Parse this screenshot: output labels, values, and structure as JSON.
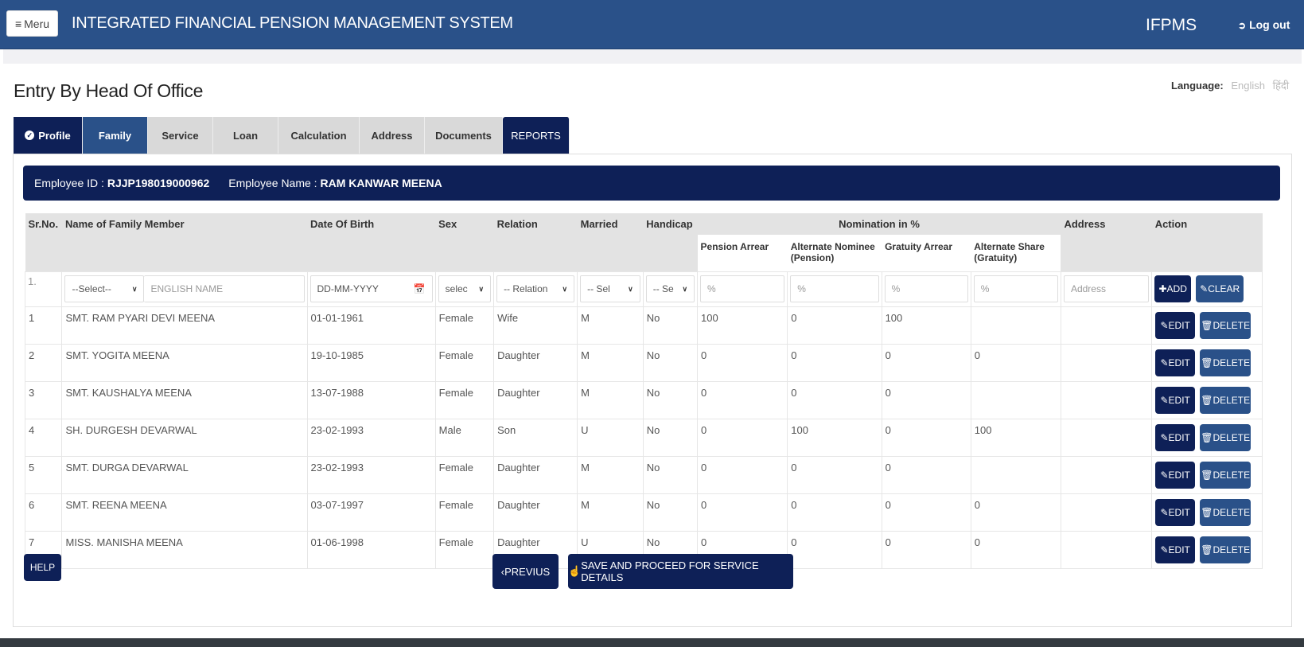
{
  "header": {
    "menu_label": "Meru",
    "app_title": "INTEGRATED FINANCIAL PENSION MANAGEMENT SYSTEM",
    "brand": "IFPMS",
    "logout_label": "Log out"
  },
  "language": {
    "label": "Language:",
    "options": [
      "English",
      "हिंदी"
    ]
  },
  "page_title": "Entry By Head Of Office",
  "tabs": [
    {
      "label": "Profile"
    },
    {
      "label": "Family"
    },
    {
      "label": "Service"
    },
    {
      "label": "Loan"
    },
    {
      "label": "Calculation"
    },
    {
      "label": "Address"
    },
    {
      "label": "Documents"
    },
    {
      "label": "REPORTS"
    }
  ],
  "employee": {
    "id_label": "Employee ID :",
    "id_value": "RJJP198019000962",
    "name_label": "Employee Name :",
    "name_value": "RAM KANWAR MEENA"
  },
  "table": {
    "headers": {
      "srno": "Sr.No.",
      "name": "Name of Family Member",
      "dob": "Date Of Birth",
      "sex": "Sex",
      "relation": "Relation",
      "married": "Married",
      "handicap": "Handicap",
      "nomination": "Nomination in %",
      "pension_arrear": "Pension Arrear",
      "alt_nominee": "Alternate Nominee (Pension)",
      "gratuity_arrear": "Gratuity Arrear",
      "alt_share": "Alternate Share (Gratuity)",
      "address": "Address",
      "action": "Action"
    },
    "input_row": {
      "srno": "1.",
      "title_select": "--Select--",
      "name_placeholder": "ENGLISH NAME",
      "dob_placeholder": "DD-MM-YYYY",
      "sex_select": "selec",
      "relation_select": "-- Relation",
      "married_select": "-- Sel",
      "handicap_select": "-- Se",
      "pct_placeholder": "%",
      "address_placeholder": "Address",
      "add_label": "ADD",
      "clear_label": "CLEAR"
    },
    "rows": [
      {
        "sr": "1",
        "name": "SMT. RAM PYARI DEVI MEENA",
        "dob": "01-01-1961",
        "sex": "Female",
        "relation": "Wife",
        "married": "M",
        "handicap": "No",
        "pension": "100",
        "alt_nominee": "0",
        "gratuity": "100",
        "alt_share": "",
        "address": ""
      },
      {
        "sr": "2",
        "name": "SMT. YOGITA MEENA",
        "dob": "19-10-1985",
        "sex": "Female",
        "relation": "Daughter",
        "married": "M",
        "handicap": "No",
        "pension": "0",
        "alt_nominee": "0",
        "gratuity": "0",
        "alt_share": "0",
        "address": ""
      },
      {
        "sr": "3",
        "name": "SMT. KAUSHALYA MEENA",
        "dob": "13-07-1988",
        "sex": "Female",
        "relation": "Daughter",
        "married": "M",
        "handicap": "No",
        "pension": "0",
        "alt_nominee": "0",
        "gratuity": "0",
        "alt_share": "",
        "address": ""
      },
      {
        "sr": "4",
        "name": "SH. DURGESH DEVARWAL",
        "dob": "23-02-1993",
        "sex": "Male",
        "relation": "Son",
        "married": "U",
        "handicap": "No",
        "pension": "0",
        "alt_nominee": "100",
        "gratuity": "0",
        "alt_share": "100",
        "address": ""
      },
      {
        "sr": "5",
        "name": "SMT. DURGA DEVARWAL",
        "dob": "23-02-1993",
        "sex": "Female",
        "relation": "Daughter",
        "married": "M",
        "handicap": "No",
        "pension": "0",
        "alt_nominee": "0",
        "gratuity": "0",
        "alt_share": "",
        "address": ""
      },
      {
        "sr": "6",
        "name": "SMT. REENA MEENA",
        "dob": "03-07-1997",
        "sex": "Female",
        "relation": "Daughter",
        "married": "M",
        "handicap": "No",
        "pension": "0",
        "alt_nominee": "0",
        "gratuity": "0",
        "alt_share": "0",
        "address": ""
      },
      {
        "sr": "7",
        "name": "MISS. MANISHA MEENA",
        "dob": "01-06-1998",
        "sex": "Female",
        "relation": "Daughter",
        "married": "U",
        "handicap": "No",
        "pension": "0",
        "alt_nominee": "0",
        "gratuity": "0",
        "alt_share": "0",
        "address": ""
      }
    ],
    "edit_label": "EDIT",
    "delete_label": "DELETE"
  },
  "footer": {
    "help_label": "HELP",
    "previous_label": "PREVIUS",
    "save_label": "SAVE AND PROCEED FOR SERVICE DETAILS"
  },
  "colors": {
    "navy": "#0e2057",
    "blue": "#2a5189",
    "header_gray": "#e3e3e3"
  }
}
